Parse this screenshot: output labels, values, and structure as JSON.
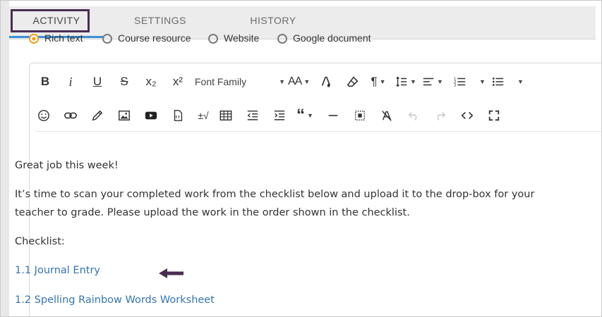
{
  "tabs": [
    {
      "label": "ACTIVITY",
      "active": true
    },
    {
      "label": "SETTINGS",
      "active": false
    },
    {
      "label": "HISTORY",
      "active": false
    }
  ],
  "source_options": [
    {
      "label": "Rich text",
      "checked": true
    },
    {
      "label": "Course resource",
      "checked": false
    },
    {
      "label": "Website",
      "checked": false
    },
    {
      "label": "Google document",
      "checked": false
    }
  ],
  "toolbar": {
    "font_family_label": "Font Family",
    "subscript_label": "x₂",
    "superscript_label": "x²",
    "font_size_label": "AA",
    "special_chars_label": "±√"
  },
  "content": {
    "line1": "Great job this week!",
    "line2": "It’s time to scan your completed work from the checklist below and upload it to the drop-box for your",
    "line3": "teacher to grade. Please upload the work in the order shown in the checklist.",
    "line4": "Checklist:",
    "link1": "1.1 Journal Entry",
    "link2": "1.2 Spelling Rainbow Words Worksheet"
  },
  "colors": {
    "tab_underline": "#3a8fd9",
    "highlight_box": "#4a2d52",
    "link": "#3574ae",
    "arrow": "#4a2d52",
    "radio_checked": "#f0a020"
  }
}
